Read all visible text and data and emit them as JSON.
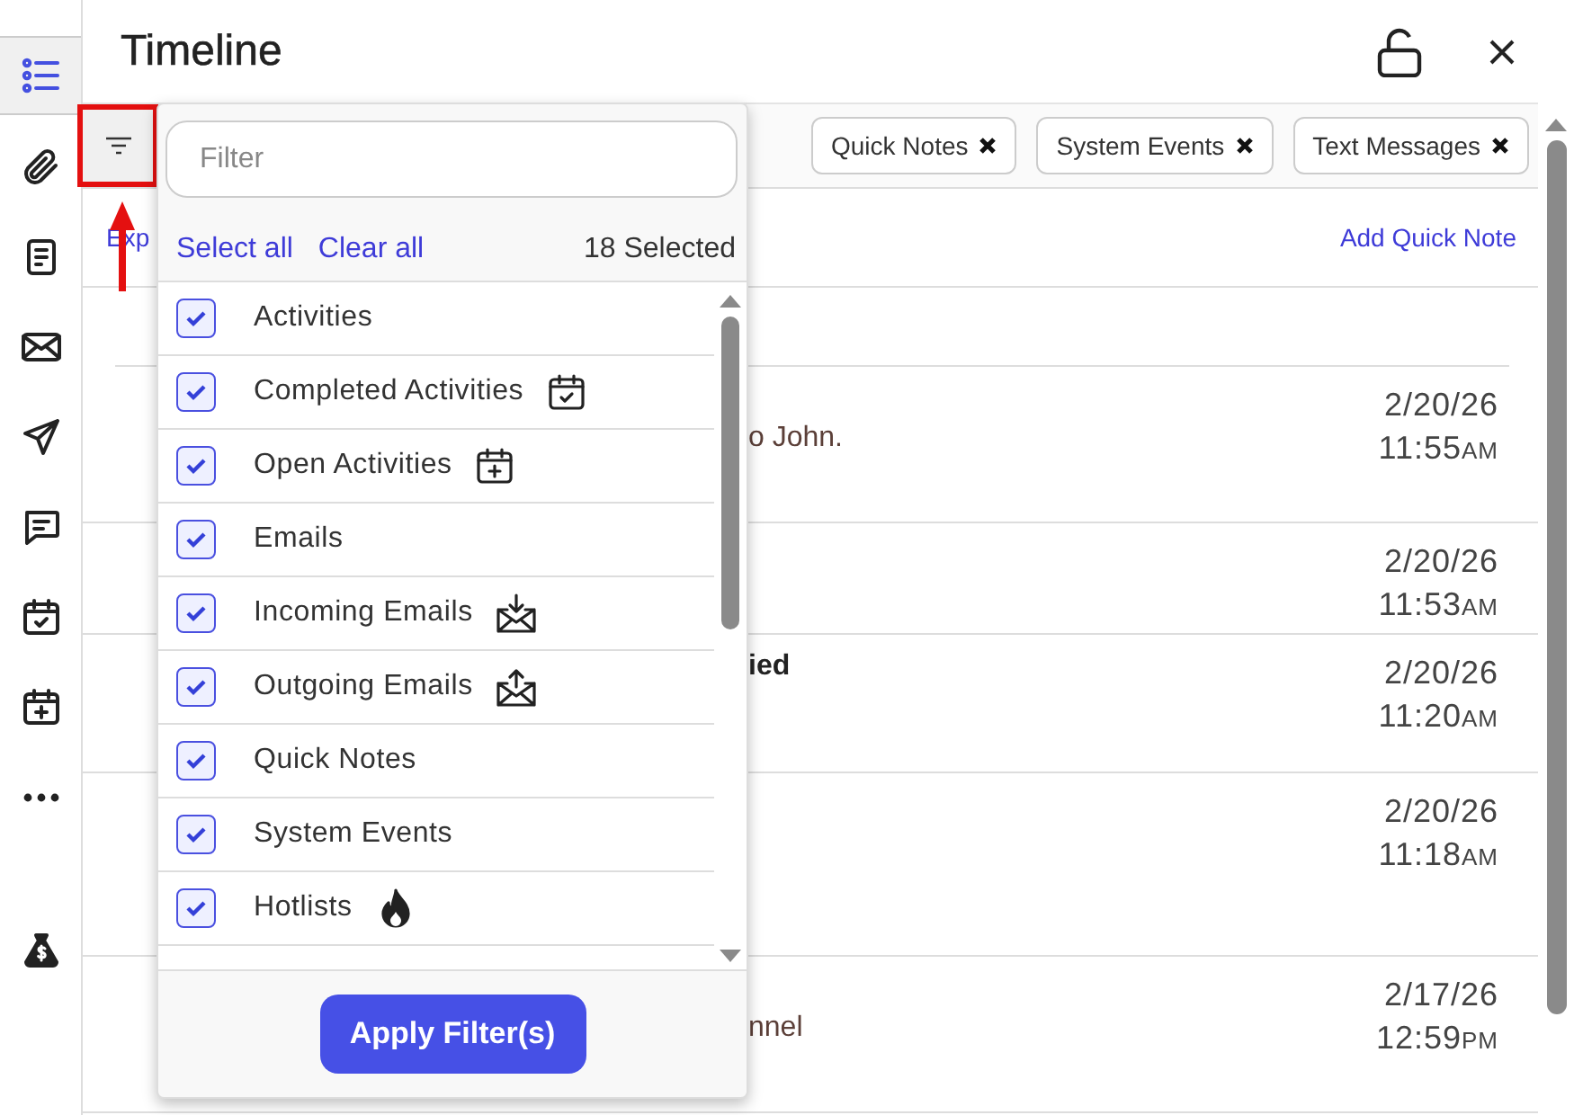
{
  "sidebar": {
    "items": [
      {
        "kind": "list",
        "selected": true
      },
      {
        "kind": "paperclip",
        "selected": false
      },
      {
        "kind": "document",
        "selected": false
      },
      {
        "kind": "envelope",
        "selected": false
      },
      {
        "kind": "send",
        "selected": false
      },
      {
        "kind": "chat",
        "selected": false
      },
      {
        "kind": "calendar-check",
        "selected": false
      },
      {
        "kind": "calendar-plus",
        "selected": false
      },
      {
        "kind": "more",
        "selected": false
      },
      {
        "kind": "money-bag",
        "selected": false
      }
    ]
  },
  "header": {
    "title": "Timeline"
  },
  "chips": [
    {
      "label": "Quick Notes"
    },
    {
      "label": "System Events"
    },
    {
      "label": "Text Messages"
    }
  ],
  "links": {
    "expand": "Exp",
    "add_note": "Add Quick Note"
  },
  "entries": [
    {
      "detail": "o John.",
      "date": "2/20/26",
      "time": "11:55",
      "meridiem": "AM"
    },
    {
      "date": "2/20/26",
      "time": "11:53",
      "meridiem": "AM"
    },
    {
      "title": "ied",
      "date": "2/20/26",
      "time": "11:20",
      "meridiem": "AM"
    },
    {
      "date": "2/20/26",
      "time": "11:18",
      "meridiem": "AM"
    },
    {
      "detail": "nnel",
      "date": "2/17/26",
      "time": "12:59",
      "meridiem": "PM"
    }
  ],
  "filter_popup": {
    "placeholder": "Filter",
    "select_all": "Select all",
    "clear_all": "Clear all",
    "count": "18 Selected",
    "items": [
      {
        "label": "Activities",
        "checked": true
      },
      {
        "label": "Completed Activities",
        "checked": true
      },
      {
        "label": "Open Activities",
        "checked": true
      },
      {
        "label": "Emails",
        "checked": true
      },
      {
        "label": "Incoming Emails",
        "checked": true
      },
      {
        "label": "Outgoing Emails",
        "checked": true
      },
      {
        "label": "Quick Notes",
        "checked": true
      },
      {
        "label": "System Events",
        "checked": true
      },
      {
        "label": "Hotlists",
        "checked": true
      }
    ],
    "apply": "Apply Filter(s)"
  }
}
